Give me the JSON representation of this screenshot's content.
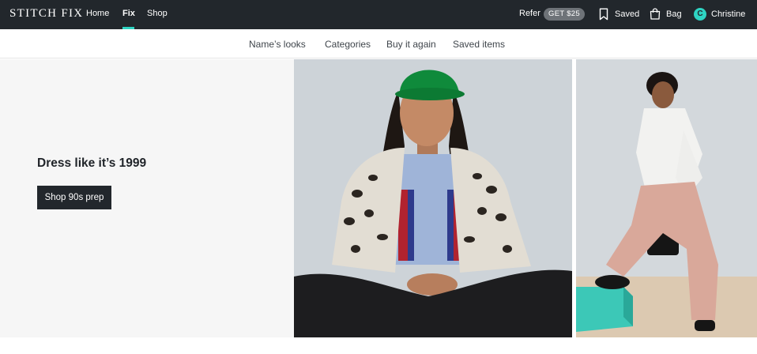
{
  "brand": {
    "logo_text": "STITCH FIX"
  },
  "topnav": {
    "links": [
      {
        "label": "Home",
        "active": false
      },
      {
        "label": "Fix",
        "active": true
      },
      {
        "label": "Shop",
        "active": false
      }
    ],
    "refer_label": "Refer",
    "refer_badge": "GET $25",
    "saved_label": "Saved",
    "bag_label": "Bag",
    "user_initial": "C",
    "user_name": "Christine",
    "icons": {
      "saved": "bookmark-icon",
      "bag": "shopping-bag-icon"
    }
  },
  "subnav": {
    "items": [
      "Name’s looks",
      "Categories",
      "Buy it again",
      "Saved items"
    ]
  },
  "hero": {
    "headline": "Dress like it’s 1999",
    "cta_label": "Shop 90s prep"
  },
  "colors": {
    "topbar_bg": "#22272c",
    "accent_teal": "#2ed3c2",
    "promo_bg": "#f6f6f6",
    "button_bg": "#22272c"
  }
}
